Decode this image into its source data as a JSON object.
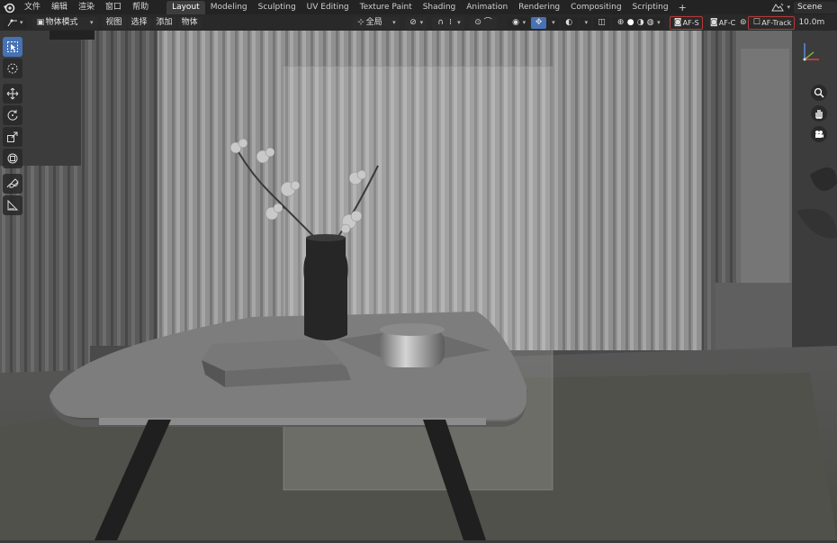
{
  "menu": {
    "items": [
      "文件",
      "编辑",
      "渲染",
      "窗口",
      "帮助"
    ]
  },
  "workspace_tabs": {
    "items": [
      "Layout",
      "Modeling",
      "Sculpting",
      "UV Editing",
      "Texture Paint",
      "Shading",
      "Animation",
      "Rendering",
      "Compositing",
      "Scripting"
    ],
    "active": "Layout",
    "add_label": "+"
  },
  "scene": {
    "name": "Scene"
  },
  "viewport_header": {
    "mode_label": "物体模式",
    "view_label": "视图",
    "select_label": "选择",
    "add_label": "添加",
    "object_label": "物体",
    "transform_orientation": "全局",
    "af_s_label": "AF-S",
    "af_c_label": "AF-C",
    "af_track_label": "AF-Track",
    "distance_label": "10.0m"
  },
  "colors": {
    "accent": "#4772b3",
    "topbar_bg": "#232323",
    "camera_toggle_outline": "#b43a3a"
  },
  "tools": [
    "select-box-icon",
    "cursor-icon",
    "move-icon",
    "rotate-icon",
    "scale-icon",
    "transform-icon",
    "annotate-icon",
    "measure-icon"
  ]
}
